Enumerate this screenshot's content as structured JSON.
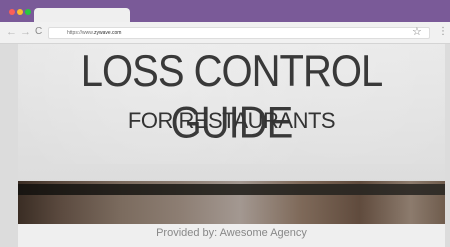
{
  "browser": {
    "url_prefix": "https://www.",
    "url_host": "zywave.com",
    "icons": {
      "back": "back-arrow-icon",
      "forward": "forward-arrow-icon",
      "reload": "reload-icon",
      "bookmark": "star-icon",
      "menu": "more-vertical-icon"
    }
  },
  "page": {
    "title": "LOSS CONTROL GUIDE",
    "subtitle": "FOR RESTAURANTS",
    "provided_by": "Provided by: Awesome Agency"
  },
  "colors": {
    "frame_purple": "#7a5a98",
    "title_text": "#393939"
  }
}
